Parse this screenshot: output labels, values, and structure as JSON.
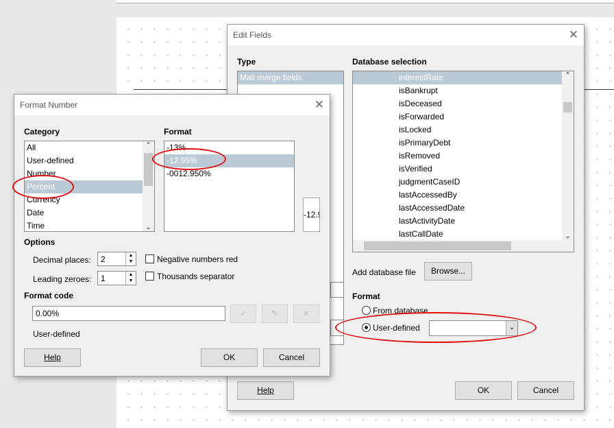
{
  "edit_fields": {
    "title": "Edit Fields",
    "type_label": "Type",
    "type_items": [
      "Mail merge fields"
    ],
    "db_label": "Database selection",
    "db_items": [
      "interestRate",
      "isBankrupt",
      "isDeceased",
      "isForwarded",
      "isLocked",
      "isPrimaryDebt",
      "isRemoved",
      "isVerified",
      "judgmentCaseID",
      "lastAccessedBy",
      "lastAccessedDate",
      "lastActivityDate",
      "lastCallDate"
    ],
    "add_db_label": "Add database file",
    "browse": "Browse...",
    "format_label": "Format",
    "from_database": "From database",
    "user_defined": "User-defined",
    "user_defined_value": "",
    "help": "Help",
    "ok": "OK",
    "cancel": "Cancel"
  },
  "format_number": {
    "title": "Format Number",
    "category_label": "Category",
    "categories": [
      "All",
      "User-defined",
      "Number",
      "Percent",
      "Currency",
      "Date",
      "Time"
    ],
    "format_label": "Format",
    "formats": [
      "-13%",
      "-12.95%",
      "-0012.950%"
    ],
    "preview": "-12.9",
    "options_label": "Options",
    "decimal_places_label": "Decimal places:",
    "decimal_places": "2",
    "leading_zeroes_label": "Leading zeroes:",
    "leading_zeroes": "1",
    "negative_red": "Negative numbers red",
    "thousands_sep": "Thousands separator",
    "format_code_label": "Format code",
    "format_code": "0.00%",
    "code_status": "User-defined",
    "help": "Help",
    "ok": "OK",
    "cancel": "Cancel"
  },
  "colors": {
    "selection": "#bccad7",
    "annotation": "#e01010"
  }
}
